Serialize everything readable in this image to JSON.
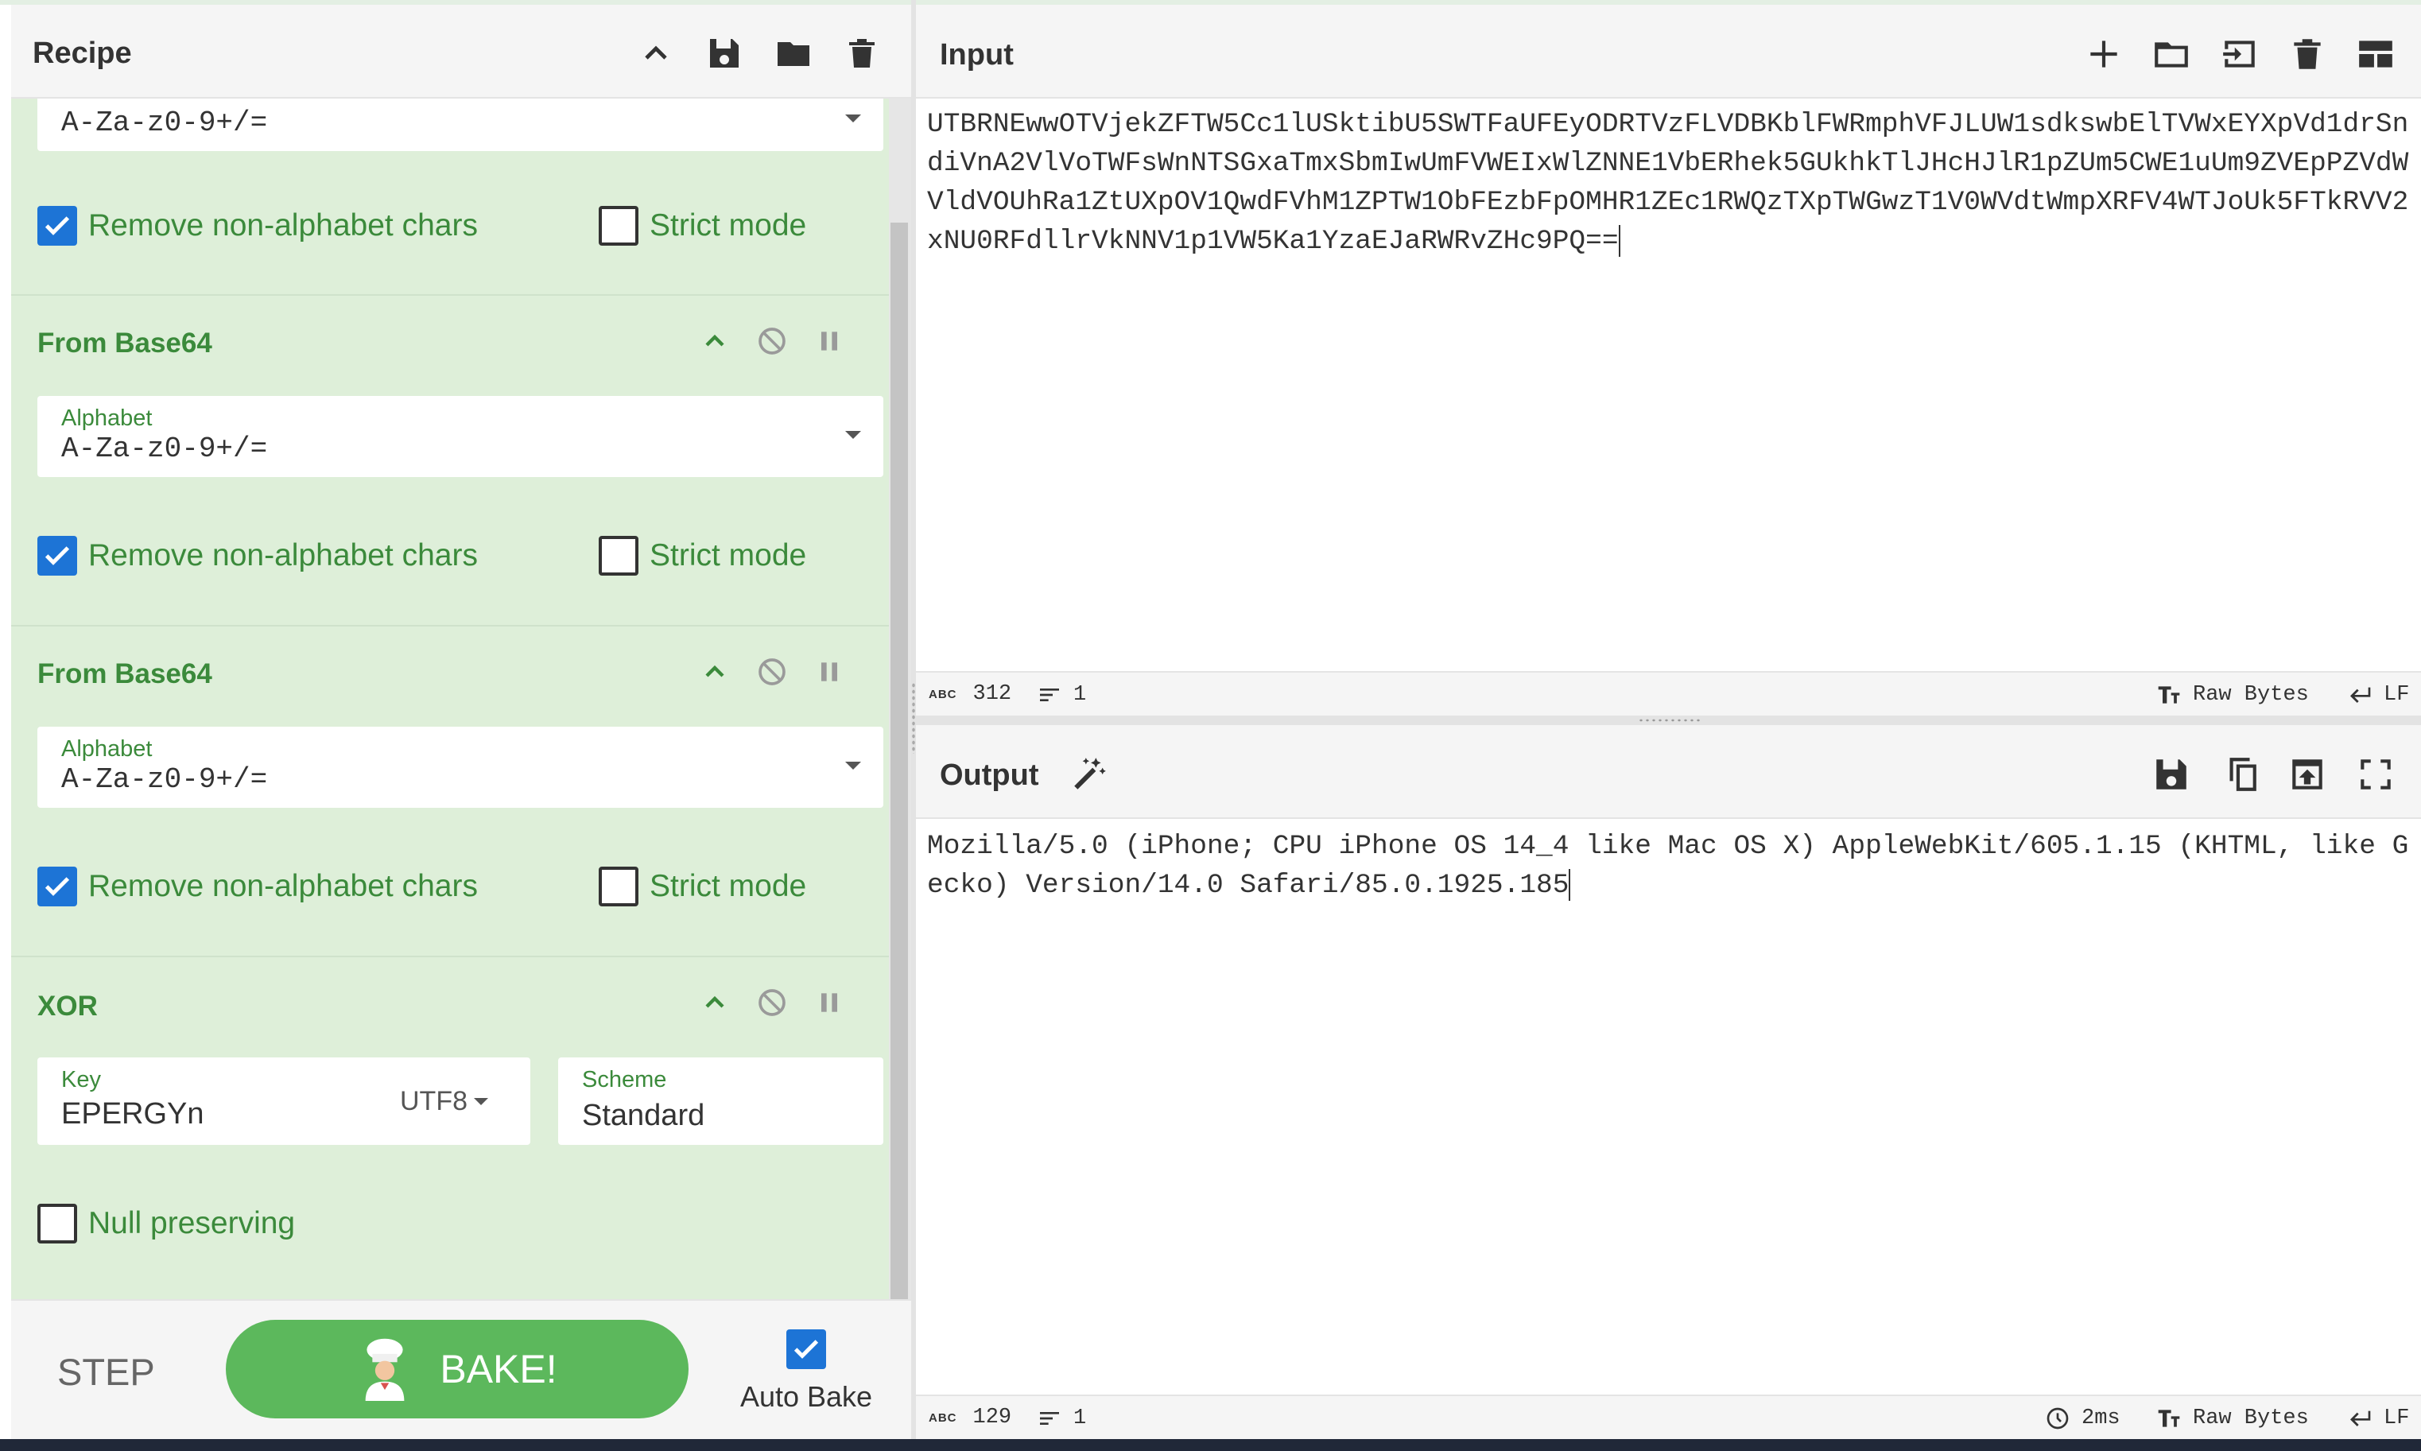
{
  "recipe": {
    "title": "Recipe",
    "icons": [
      "chevron-up-icon",
      "save-icon",
      "folder-icon",
      "trash-icon"
    ],
    "partial_op": {
      "alphabet_value": "A-Za-z0-9+/=",
      "remove_non_alphabet_label": "Remove non-alphabet chars",
      "remove_non_alphabet_checked": true,
      "strict_mode_label": "Strict mode",
      "strict_mode_checked": false
    },
    "operations": [
      {
        "title": "From Base64",
        "alphabet_label": "Alphabet",
        "alphabet_value": "A-Za-z0-9+/=",
        "remove_non_alphabet_label": "Remove non-alphabet chars",
        "remove_non_alphabet_checked": true,
        "strict_mode_label": "Strict mode",
        "strict_mode_checked": false
      },
      {
        "title": "From Base64",
        "alphabet_label": "Alphabet",
        "alphabet_value": "A-Za-z0-9+/=",
        "remove_non_alphabet_label": "Remove non-alphabet chars",
        "remove_non_alphabet_checked": true,
        "strict_mode_label": "Strict mode",
        "strict_mode_checked": false
      }
    ],
    "xor": {
      "title": "XOR",
      "key_label": "Key",
      "key_value": "EPERGYn",
      "key_encoding": "UTF8",
      "scheme_label": "Scheme",
      "scheme_value": "Standard",
      "null_preserving_label": "Null preserving",
      "null_preserving_checked": false
    },
    "controls": {
      "step_label": "STEP",
      "bake_label": "BAKE!",
      "autobake_label": "Auto Bake",
      "autobake_checked": true
    }
  },
  "input": {
    "title": "Input",
    "text": "UTBRNEwwOTVjekZFTW5Cc1lUSktibU5SWTFaUFEyODRTVzFLVDBKblFWRmphVFJLUW1sdkswbElTVWxEYXpVd1drSndiVnA2VlVoTWFsWnNTSGxaTmxSbmIwUmFVWEIxWlZNNE1VbERhek5GUkhkTlJHcHJlR1pZUm5CWE1uUm9ZVEpPZVdWVldVOUhRa1ZtUXpOV1QwdFVhM1ZPTW1ObFEzbFpOMHR1ZEc1RWQzTXpTWGwzT1V0WVdtWmpXRFV4WTJoUk5FTkRVV2xNU0RFdllrVkNNV1p1VW5Ka1YzaEJaRWRvZHc9PQ==",
    "status": {
      "length": "312",
      "lines": "1",
      "format": "Raw Bytes",
      "eol": "LF"
    },
    "icons": [
      "plus-icon",
      "folder-icon",
      "sign-in-icon",
      "trash-icon",
      "layout-icon"
    ]
  },
  "output": {
    "title": "Output",
    "text": "Mozilla/5.0 (iPhone; CPU iPhone OS 14_4 like Mac OS X) AppleWebKit/605.1.15 (KHTML, like Gecko) Version/14.0 Safari/85.0.1925.185",
    "status": {
      "length": "129",
      "lines": "1",
      "time": "2ms",
      "format": "Raw Bytes",
      "eol": "LF"
    },
    "icons": [
      "magic-wand-icon",
      "save-icon",
      "copy-icon",
      "replace-input-icon",
      "fullscreen-icon"
    ]
  }
}
